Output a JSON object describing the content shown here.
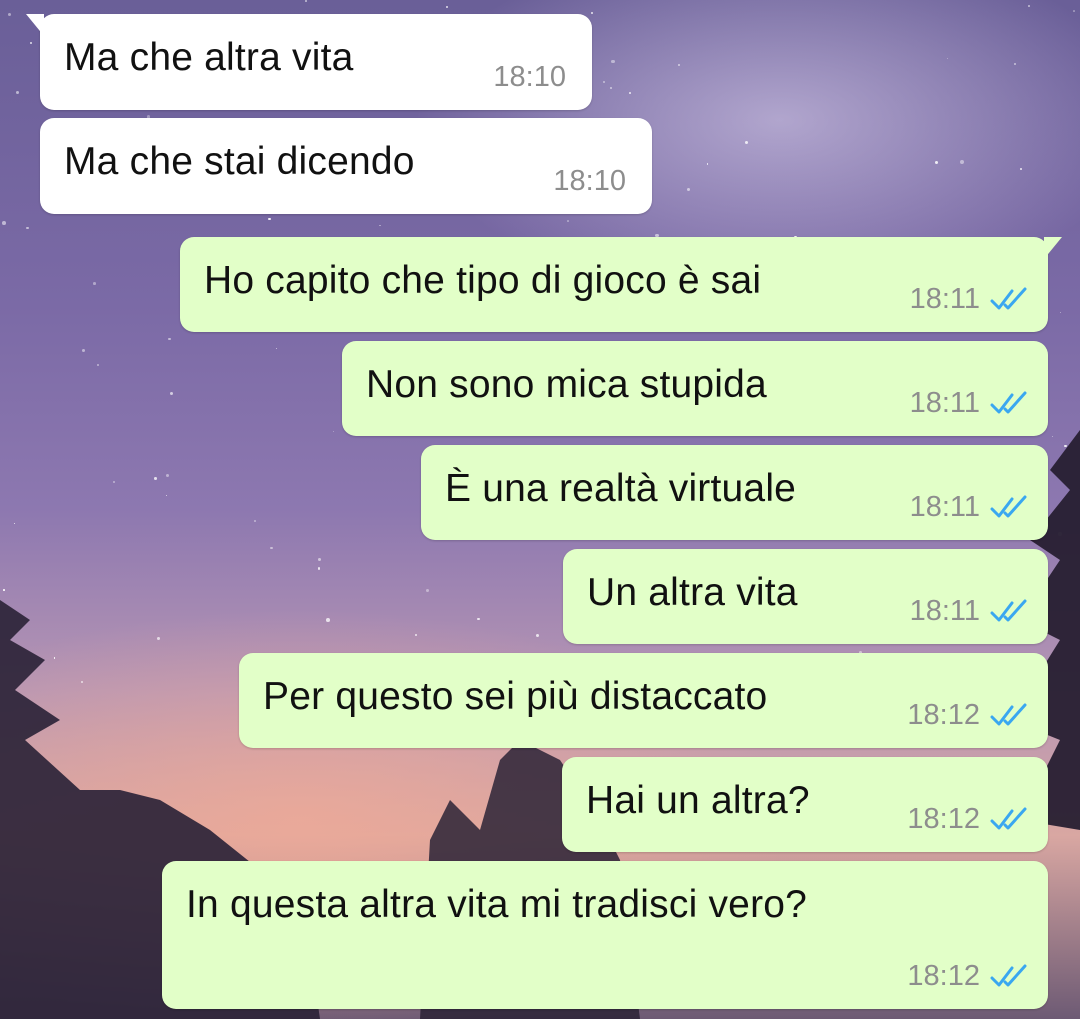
{
  "colors": {
    "incoming_bubble": "#ffffff",
    "outgoing_bubble": "#e2ffc8",
    "timestamp": "#8d8d8d",
    "read_tick": "#3aa7f0"
  },
  "messages": [
    {
      "direction": "incoming",
      "text": "Ma che altra vita",
      "time": "18:10"
    },
    {
      "direction": "incoming",
      "text": "Ma che stai dicendo",
      "time": "18:10"
    },
    {
      "direction": "outgoing",
      "text": "Ho capito che tipo di gioco è sai",
      "time": "18:11",
      "status_icon": "double-check-read-icon"
    },
    {
      "direction": "outgoing",
      "text": "Non sono mica stupida",
      "time": "18:11",
      "status_icon": "double-check-read-icon"
    },
    {
      "direction": "outgoing",
      "text": "È una realtà virtuale",
      "time": "18:11",
      "status_icon": "double-check-read-icon"
    },
    {
      "direction": "outgoing",
      "text": "Un altra vita",
      "time": "18:11",
      "status_icon": "double-check-read-icon"
    },
    {
      "direction": "outgoing",
      "text": "Per questo sei più distaccato",
      "time": "18:12",
      "status_icon": "double-check-read-icon"
    },
    {
      "direction": "outgoing",
      "text": "Hai un altra?",
      "time": "18:12",
      "status_icon": "double-check-read-icon"
    },
    {
      "direction": "outgoing",
      "text": "In questa altra vita mi tradisci vero?",
      "time": "18:12",
      "status_icon": "double-check-read-icon"
    }
  ]
}
